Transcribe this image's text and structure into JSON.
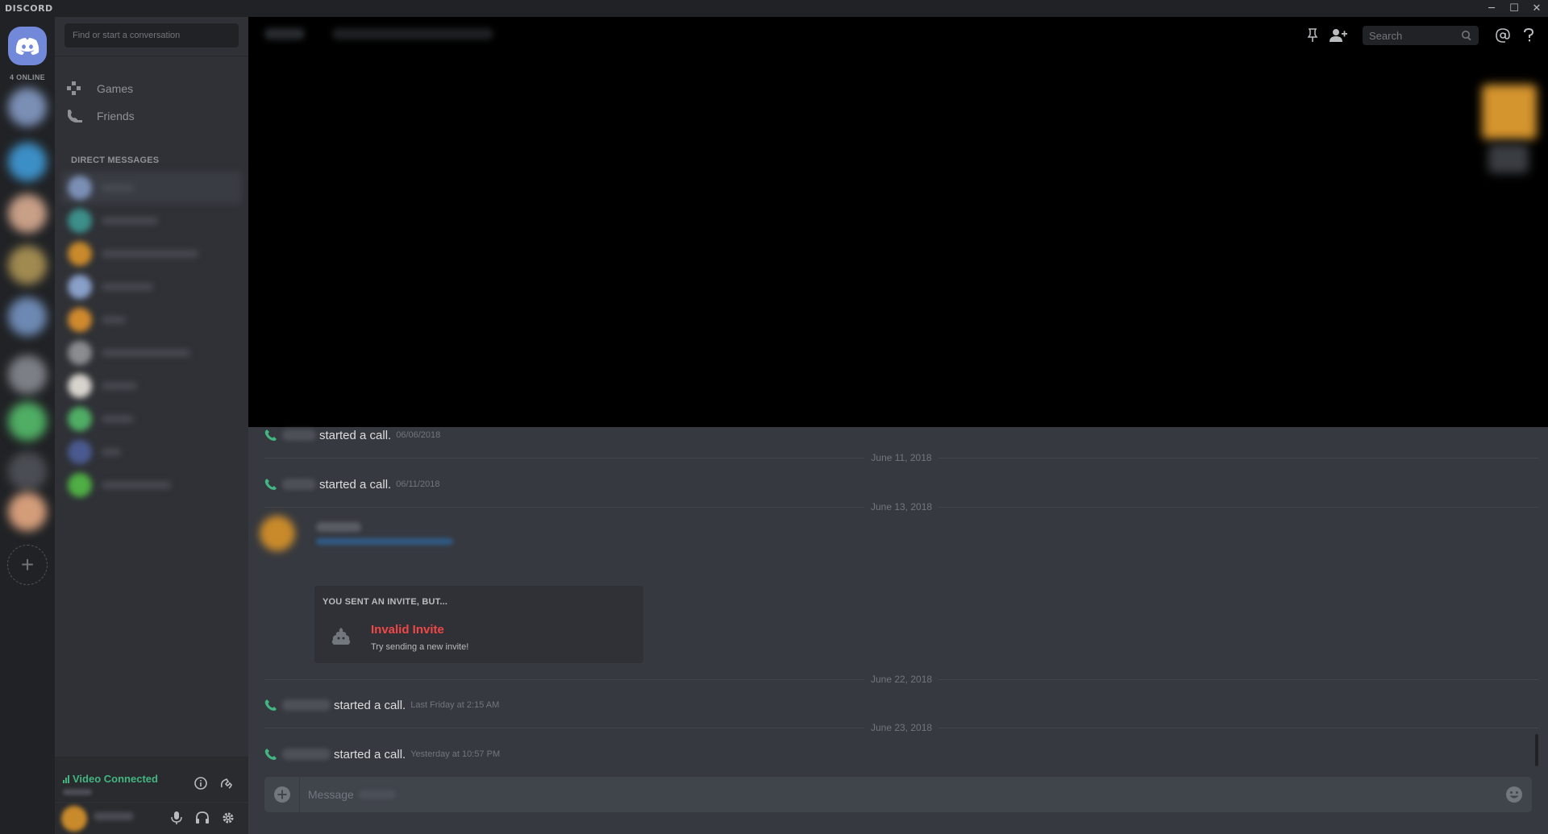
{
  "window": {
    "brand": "DISCORD",
    "controls": {
      "minimize": "─",
      "maximize": "☐",
      "close": "✕"
    }
  },
  "guilds": {
    "online_count": "4 ONLINE",
    "add_icon": "+",
    "colors": [
      "#7b8fb5",
      "#3c8fc6",
      "#c89f87",
      "#a08a50",
      "#6d89b3",
      "#7c8086",
      "#4fae64",
      "#5a5d63",
      "#d49d7a"
    ]
  },
  "sidebar": {
    "search_placeholder": "Find or start a conversation",
    "nav": [
      {
        "label": "Games",
        "icon": "gamepad-icon"
      },
      {
        "label": "Friends",
        "icon": "friends-icon"
      }
    ],
    "dm_header": "DIRECT MESSAGES",
    "dm_colors": [
      "#7b8fb5",
      "#3c8f8a",
      "#c98a2b",
      "#8aa0c9",
      "#d08a2e",
      "#8a8c90",
      "#d7d3cd",
      "#4fae64",
      "#4a5a90",
      "#4fae44"
    ]
  },
  "voice": {
    "status": "Video Connected",
    "status_color": "#43b581"
  },
  "header": {
    "search_placeholder": "Search",
    "icons": [
      "pin-icon",
      "add-member-icon",
      "search-icon",
      "mention-icon",
      "help-icon"
    ]
  },
  "messages": {
    "call1": {
      "text": "started a call.",
      "ts": "06/06/2018"
    },
    "div1": "June 11, 2018",
    "call2": {
      "text": "started a call.",
      "ts": "06/11/2018"
    },
    "div2": "June 13, 2018",
    "invite": {
      "header": "YOU SENT AN INVITE, BUT...",
      "title": "Invalid Invite",
      "subtitle": "Try sending a new invite!",
      "title_color": "#f04747"
    },
    "div3": "June 22, 2018",
    "call3": {
      "text": "started a call.",
      "ts": "Last Friday at 2:15 AM"
    },
    "div4": "June 23, 2018",
    "call4": {
      "text": "started a call.",
      "ts": "Yesterday at 10:57 PM"
    }
  },
  "composer": {
    "placeholder": "Message"
  }
}
